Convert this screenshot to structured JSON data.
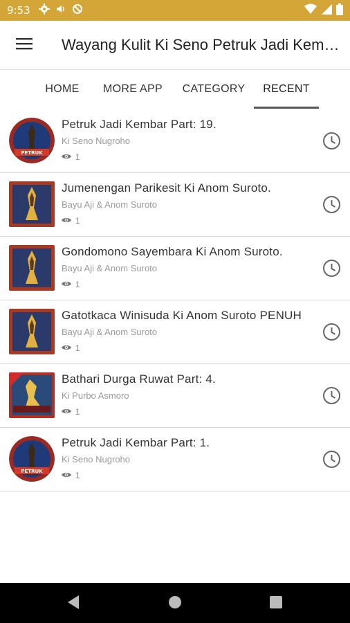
{
  "status_bar": {
    "time": "9:53",
    "icons_left": [
      "gear-icon",
      "volume-icon",
      "blocked-icon"
    ],
    "icons_right": [
      "wifi-icon",
      "signal-icon",
      "battery-icon"
    ],
    "background": "#d4a537"
  },
  "app_bar": {
    "title": "Wayang Kulit Ki Seno Petruk Jadi Kembar",
    "menu_icon": "hamburger-menu-icon"
  },
  "tabs": [
    {
      "label": "HOME",
      "active": false
    },
    {
      "label": "MORE APP",
      "active": false
    },
    {
      "label": "CATEGORY",
      "active": false
    },
    {
      "label": "RECENT",
      "active": true
    }
  ],
  "items": [
    {
      "title": "Petruk Jadi Kembar Part: 19.",
      "artist": "Ki Seno Nugroho",
      "views": "1"
    },
    {
      "title": "Jumenengan Parikesit   Ki Anom Suroto.",
      "artist": "Bayu Aji & Anom Suroto",
      "views": "1"
    },
    {
      "title": "Gondomono Sayembara   Ki Anom Suroto.",
      "artist": "Bayu Aji & Anom Suroto",
      "views": "1"
    },
    {
      "title": "Gatotkaca Winisuda   Ki Anom Suroto PENUH",
      "artist": "Bayu Aji & Anom Suroto",
      "views": "1"
    },
    {
      "title": "Bathari Durga Ruwat Part: 4.",
      "artist": "Ki Purbo Asmoro",
      "views": "1"
    },
    {
      "title": "Petruk Jadi Kembar Part: 1.",
      "artist": "Ki Seno Nugroho",
      "views": "1"
    }
  ],
  "nav_bar": {
    "back": "back-icon",
    "home": "home-icon",
    "recents": "recents-icon"
  }
}
